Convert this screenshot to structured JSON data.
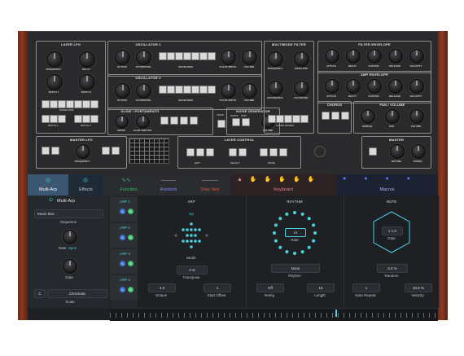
{
  "synth": {
    "layer_lfo": {
      "title": "LAYER LFO",
      "knobs": [
        "FREQUENCY",
        "DELAY",
        "DEPTH 1",
        "DEPTH 2"
      ],
      "buttons_label": "WAVEFORM",
      "depth_labels": [
        "DEPTH 1",
        "DEPTH 2"
      ]
    },
    "osc1": {
      "title": "OSCILLATOR 1",
      "knobs": [
        "OCTAVE",
        "TRANSPOSE",
        "DETUNE",
        "PULSE WIDTH",
        "VOLUME"
      ],
      "group": "WAVEFORM"
    },
    "osc2": {
      "title": "OSCILLATOR 2",
      "knobs": [
        "OCTAVE",
        "TRANSPOSE",
        "DETUNE",
        "PULSE WIDTH",
        "VOLUME"
      ],
      "group": "WAVEFORM"
    },
    "filter": {
      "title": "MULTIMODE FILTER",
      "knobs": [
        "FREQUENCY",
        "ENVELOPE",
        "RESONANCE",
        "KEYBOARD"
      ],
      "group": "FILTER MODES",
      "modes": [
        "LPF",
        "LPS",
        "BPF",
        "BRF",
        "HPF"
      ]
    },
    "filter_env": {
      "title": "FILTER ENVELOPE",
      "knobs": [
        "ATTACK",
        "DECAY",
        "SUSTAIN",
        "RELEASE",
        "VELOCITY"
      ]
    },
    "amp_env": {
      "title": "AMP ENVELOPE",
      "knobs": [
        "ATTACK",
        "DECAY",
        "SUSTAIN",
        "RELEASE",
        "VELOCITY"
      ]
    },
    "glide": {
      "title": "GLIDE / PORTAMENTO",
      "knobs": [
        "SPEED",
        "GLIDE AMOUNT"
      ]
    },
    "noise": {
      "title": "NOISE GENERATOR",
      "labels": [
        "WHITE",
        "PINK"
      ],
      "knob": "VOLUME"
    },
    "chorus": {
      "title": "CHORUS"
    },
    "pan": {
      "title": "PAN / VOLUME",
      "knobs": [
        "SPREAD",
        "PAN",
        "VOLUME"
      ]
    },
    "master_lfo": {
      "title": "MASTER LFO",
      "knob": "FREQUENCY"
    },
    "layer_control": {
      "title": "LAYER CONTROL",
      "groups": [
        "EDIT",
        "SELECT",
        "MODE"
      ]
    },
    "master": {
      "title": "MASTER",
      "knobs": [
        "DETUNE",
        "TUNING"
      ]
    },
    "vmod": "VMOD"
  },
  "tabs": [
    {
      "label": "Multi-Arp",
      "icon": "arp-icon",
      "active": true
    },
    {
      "label": "Effects",
      "icon": "effects-icon"
    },
    {
      "label": "Function",
      "icon": "wave-icon"
    },
    {
      "label": "Random",
      "icon": "random-icon"
    },
    {
      "label": "Step Seq",
      "icon": "stepseq-icon"
    },
    {
      "label": "Keyboard",
      "icon": "keyboard-icon"
    },
    {
      "label": "Macros",
      "icon": "macros-icon"
    }
  ],
  "multi_arp": {
    "title": "Multi-Arp",
    "sequence_value": "Music Box",
    "sequence_label": "Sequence",
    "rate_label": "Rate",
    "rate_mode": "Sync",
    "gate_label": "Gate",
    "scale_root": "C",
    "scale_value": "Chromatic",
    "scale_label": "Scale"
  },
  "arp_list": [
    {
      "label": "ARP 1",
      "buttons": [
        "A",
        "B"
      ]
    },
    {
      "label": "ARP 2",
      "buttons": [
        "A",
        "B"
      ]
    },
    {
      "label": "ARP 3",
      "buttons": [
        "A",
        "B"
      ]
    },
    {
      "label": "ARP 4",
      "buttons": [
        "A",
        "B"
      ]
    }
  ],
  "arp": {
    "title": "ARP",
    "direction": "Up",
    "mode_label": "Mode",
    "transpose_value": "0 st",
    "transpose_label": "Transpose",
    "octave_value": "4.0",
    "octave_label": "Octave",
    "start_offset_value": "1",
    "start_offset_label": "Start Offset"
  },
  "rhythm": {
    "title": "RHYTHM",
    "rate_value": "x1",
    "rate_label": "Rate",
    "rhythm_value": "None",
    "rhythm_label": "Rhythm",
    "retrig_value": "Off",
    "retrig_label": "Retrig",
    "length_value": "16",
    "length_label": "Length"
  },
  "note": {
    "title": "NOTE",
    "gate_value": "x 1.0",
    "gate_label": "Gate",
    "random_value": "0.0 %",
    "random_label": "Random",
    "repeat_value": "1",
    "repeat_label": "Note Repeat",
    "velocity_value": "20.8 %",
    "velocity_label": "Velocity"
  },
  "colors": {
    "accent": "#4ecfe0",
    "green": "#3bbf6b",
    "blue": "#3b6fd8",
    "stepseq": "#e1533d",
    "keyboard": "#e9818f"
  }
}
